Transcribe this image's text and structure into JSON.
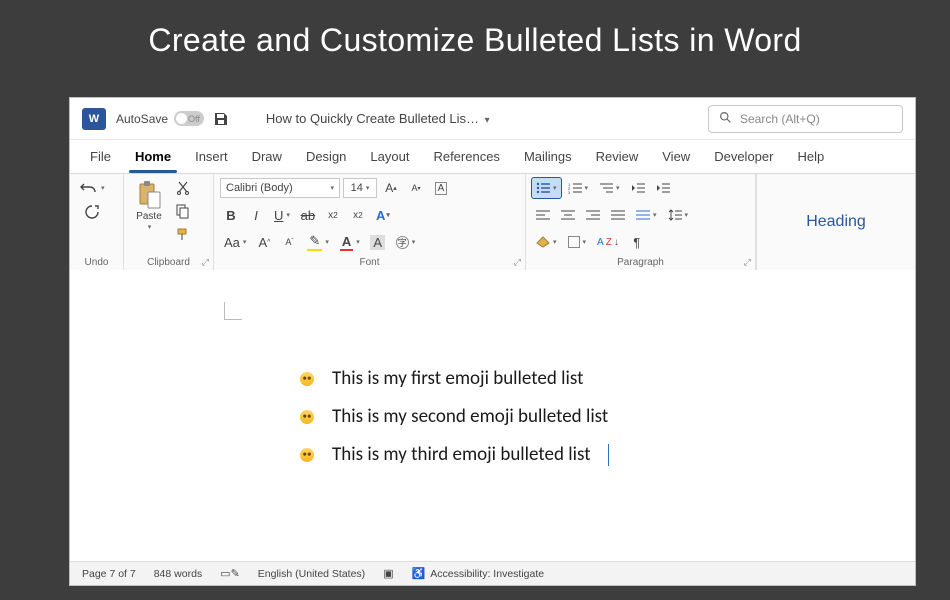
{
  "slide_title": "Create and Customize Bulleted Lists in Word",
  "title_bar": {
    "app_badge": "W",
    "autosave_label": "AutoSave",
    "autosave_state": "Off",
    "doc_title": "How to Quickly Create Bulleted Lis…",
    "search_placeholder": "Search (Alt+Q)"
  },
  "menu_tabs": [
    "File",
    "Home",
    "Insert",
    "Draw",
    "Design",
    "Layout",
    "References",
    "Mailings",
    "Review",
    "View",
    "Developer",
    "Help"
  ],
  "active_tab": "Home",
  "ribbon": {
    "undo_group": "Undo",
    "clipboard_group": "Clipboard",
    "paste_label": "Paste",
    "font_group": "Font",
    "font_name": "Calibri (Body)",
    "font_size": "14",
    "paragraph_group": "Paragraph",
    "styles_item": "Heading"
  },
  "document": {
    "bullets": [
      "This is my first emoji bulleted list",
      "This is my second emoji bulleted list",
      "This is my third emoji bulleted list"
    ]
  },
  "status": {
    "page": "Page 7 of 7",
    "words": "848 words",
    "language": "English (United States)",
    "accessibility": "Accessibility: Investigate"
  }
}
